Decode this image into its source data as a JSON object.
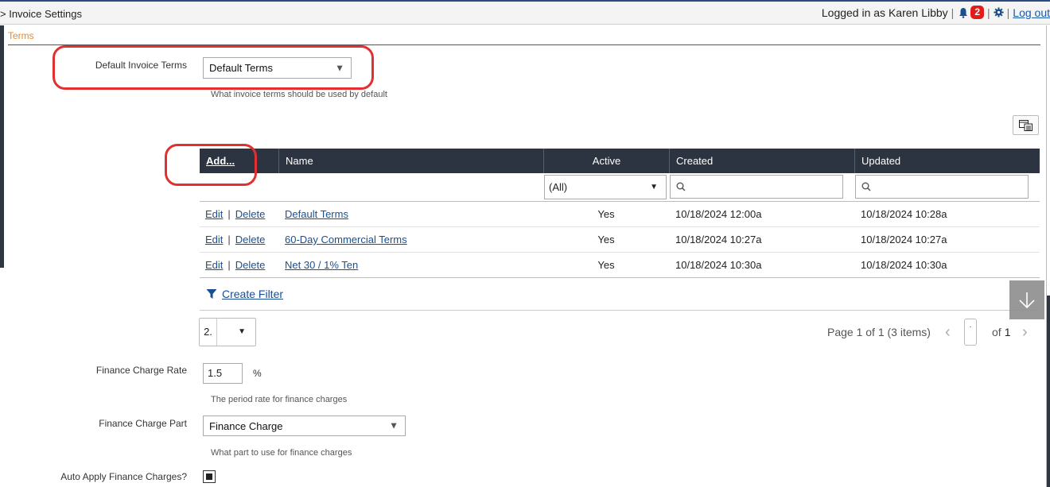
{
  "header": {
    "breadcrumb": "> Invoice Settings",
    "logged_in_text": "Logged in as Karen Libby",
    "notification_count": "2",
    "logout_label": "Log out"
  },
  "tabs": {
    "active": "Terms"
  },
  "default_terms": {
    "label": "Default Invoice Terms",
    "value": "Default Terms",
    "hint": "What invoice terms should be used by default"
  },
  "grid": {
    "columns": {
      "add": "Add...",
      "name": "Name",
      "active": "Active",
      "created": "Created",
      "updated": "Updated"
    },
    "filter_active_value": "(All)",
    "edit_label": "Edit",
    "delete_label": "Delete",
    "rows": [
      {
        "name": "Default Terms",
        "active": "Yes",
        "created": "10/18/2024 12:00a",
        "updated": "10/18/2024 10:28a"
      },
      {
        "name": "60-Day Commercial Terms",
        "active": "Yes",
        "created": "10/18/2024 10:27a",
        "updated": "10/18/2024 10:27a"
      },
      {
        "name": "Net 30 / 1% Ten",
        "active": "Yes",
        "created": "10/18/2024 10:30a",
        "updated": "10/18/2024 10:30a"
      }
    ],
    "create_filter_label": "Create Filter",
    "page_size": "2.",
    "page_info": "Page 1 of 1 (3 items)",
    "page_current": "·",
    "page_of": "of",
    "page_total": "1"
  },
  "finance_rate": {
    "label": "Finance Charge Rate",
    "value": "1.5",
    "unit": "%",
    "hint": "The period rate for finance charges"
  },
  "finance_part": {
    "label": "Finance Charge Part",
    "value": "Finance Charge",
    "hint": "What part to use for finance charges"
  },
  "auto_apply": {
    "label": "Auto Apply Finance Charges?",
    "checked": true
  },
  "colors": {
    "header_bg": "#2b3440",
    "highlight": "#e03030",
    "tab": "#f0891a",
    "link": "#1a4f8f"
  }
}
